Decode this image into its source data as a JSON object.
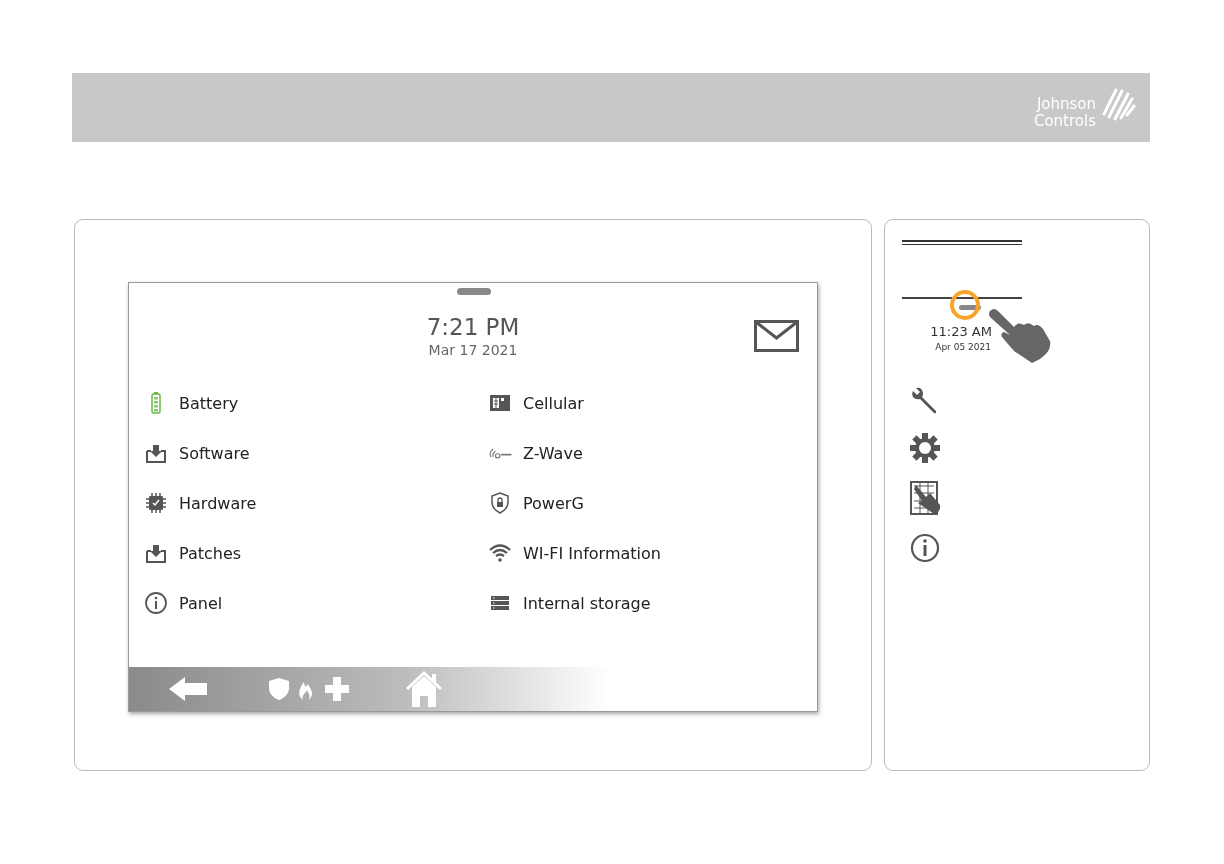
{
  "header": {
    "logo": [
      "Johnson",
      "Controls"
    ]
  },
  "panel": {
    "time": "7:21 PM",
    "date": "Mar 17 2021",
    "items": [
      {
        "kind": "battery",
        "label": "Battery"
      },
      {
        "kind": "cellular",
        "label": "Cellular"
      },
      {
        "kind": "download",
        "label": "Software"
      },
      {
        "kind": "zwave",
        "label": "Z-Wave"
      },
      {
        "kind": "chip",
        "label": "Hardware"
      },
      {
        "kind": "shield",
        "label": "PowerG"
      },
      {
        "kind": "download",
        "label": "Patches"
      },
      {
        "kind": "wifi",
        "label": "WI-FI Information"
      },
      {
        "kind": "info",
        "label": "Panel"
      },
      {
        "kind": "storage",
        "label": "Internal storage"
      }
    ]
  },
  "side": {
    "time": "11:23 AM",
    "date": "Apr 05 2021"
  }
}
